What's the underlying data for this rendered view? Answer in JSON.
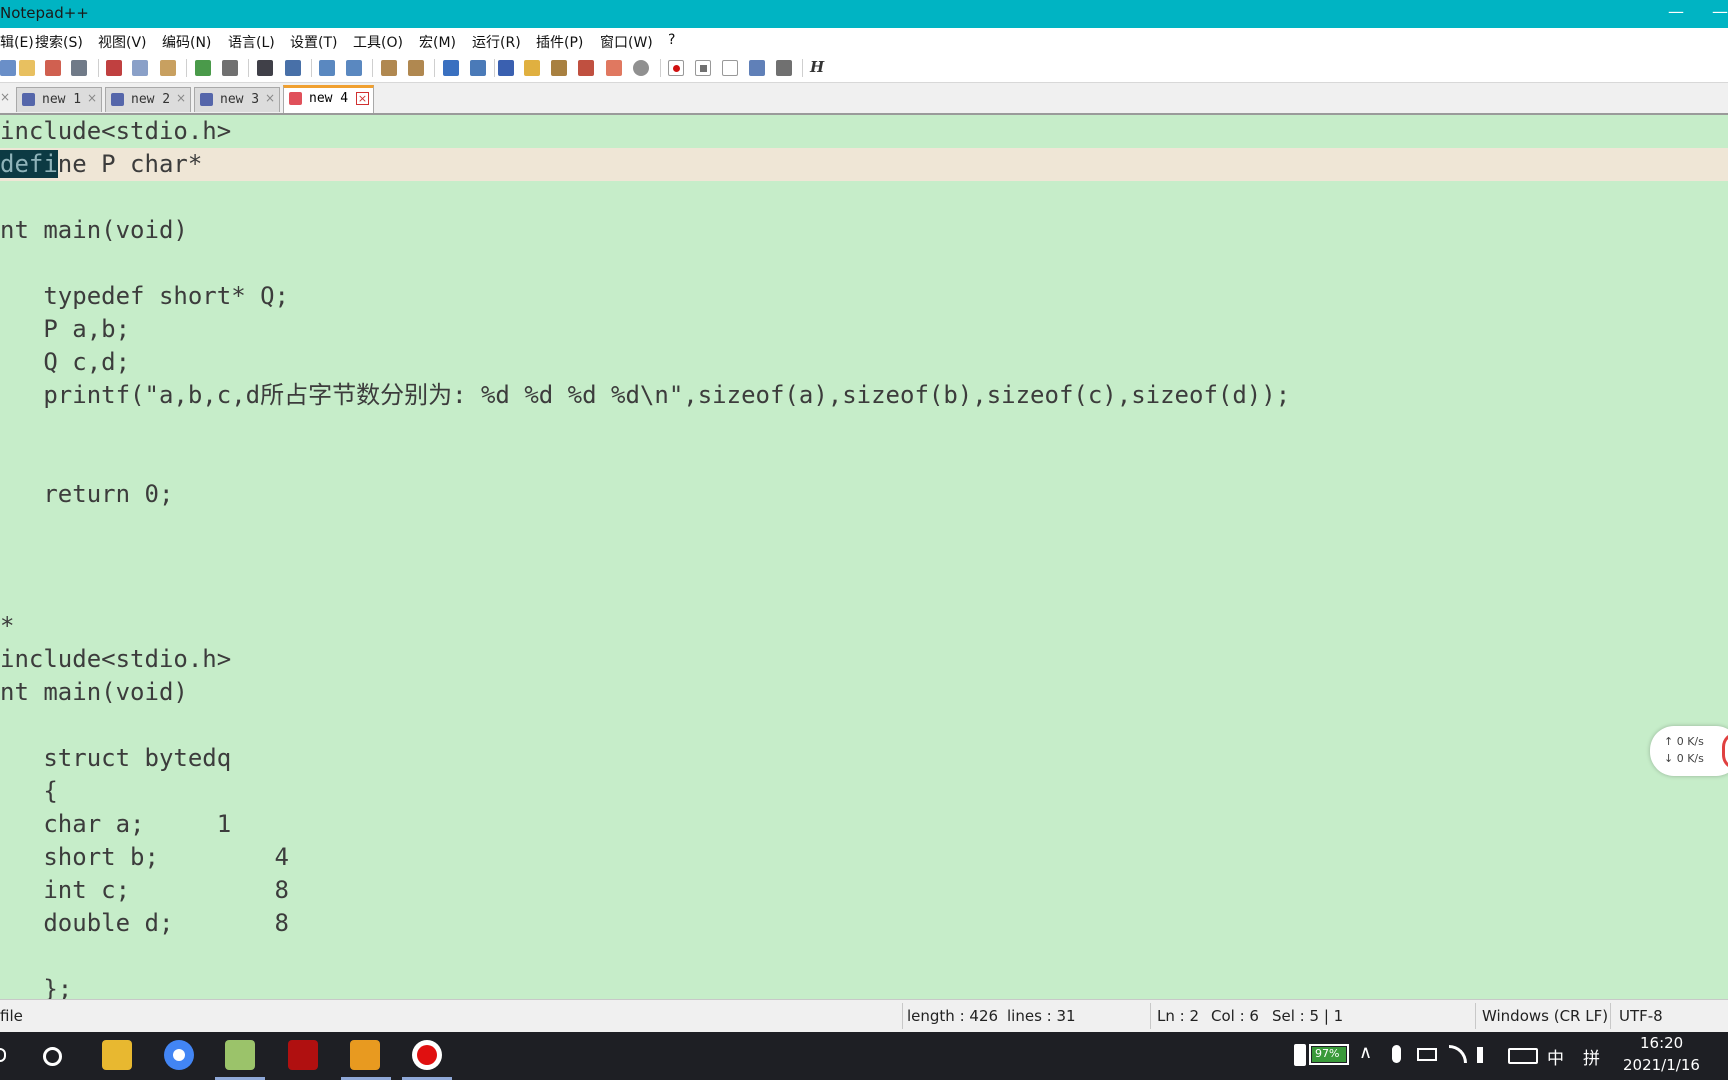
{
  "window": {
    "title": "Notepad++",
    "minimize_glyph": "—"
  },
  "menubar": {
    "items": [
      "辑(E)",
      "搜索(S)",
      "视图(V)",
      "编码(N)",
      "语言(L)",
      "设置(T)",
      "工具(O)",
      "宏(M)",
      "运行(R)",
      "插件(P)",
      "窗口(W)",
      "?"
    ]
  },
  "toolbar": {
    "icons": [
      "new-file-icon",
      "open-file-icon",
      "save-icon",
      "save-all-icon",
      "print-icon",
      "cut-icon",
      "copy-icon",
      "paste-icon",
      "undo-icon",
      "redo-icon",
      "find-icon",
      "replace-icon",
      "zoom-in-icon",
      "zoom-out-icon",
      "sync-v-icon",
      "sync-h-icon",
      "wrap-icon",
      "show-all-chars-icon",
      "indent-guide-icon",
      "doc-map-icon",
      "function-list-icon",
      "folder-workspace-icon",
      "monitor-icon",
      "record-macro-icon",
      "stop-macro-icon",
      "play-macro-icon",
      "run-macro-multiple-icon",
      "save-macro-icon"
    ],
    "italic_h": "H"
  },
  "tabs": [
    {
      "label": "new 1",
      "active": false
    },
    {
      "label": "new 2",
      "active": false
    },
    {
      "label": "new 3",
      "active": false
    },
    {
      "label": "new 4",
      "active": true
    }
  ],
  "tab_close_glyph": "×",
  "editor": {
    "lines": [
      "include<stdio.h>",
      "define P char*",
      "",
      "nt main(void)",
      "",
      "   typedef short* Q;",
      "   P a,b;",
      "   Q c,d;",
      "   printf(\"a,b,c,d所占字节数分别为: %d %d %d %d\\n\",sizeof(a),sizeof(b),sizeof(c),sizeof(d));",
      "",
      "",
      "   return 0;",
      "",
      "",
      "",
      "*",
      "include<stdio.h>",
      "nt main(void)",
      "",
      "   struct bytedq",
      "   {",
      "   char a;     1",
      "   short b;        4",
      "   int c;          8",
      "   double d;       8",
      "",
      "   };"
    ],
    "current_line_index": 1,
    "selected_prefix": "defi",
    "current_line_rest": "ne P char*"
  },
  "statusbar": {
    "file_type": "file",
    "length": "length : 426",
    "lines": "lines : 31",
    "ln": "Ln : 2",
    "col": "Col : 6",
    "sel": "Sel : 5 | 1",
    "eol": "Windows (CR LF)",
    "encoding": "UTF-8"
  },
  "net_widget": {
    "up": "↑ 0   K/s",
    "down": "↓ 0   K/s"
  },
  "taskbar": {
    "battery": "97%",
    "ime_lang": "中",
    "ime_mode": "拼",
    "time": "16:20",
    "date": "2021/1/16"
  },
  "colors": {
    "titlebar": "#00b4c3",
    "editor_bg": "#c6edc9",
    "current_line": "#efe6d6",
    "selection": "#0c3a43",
    "active_tab_accent": "#f0a030"
  }
}
